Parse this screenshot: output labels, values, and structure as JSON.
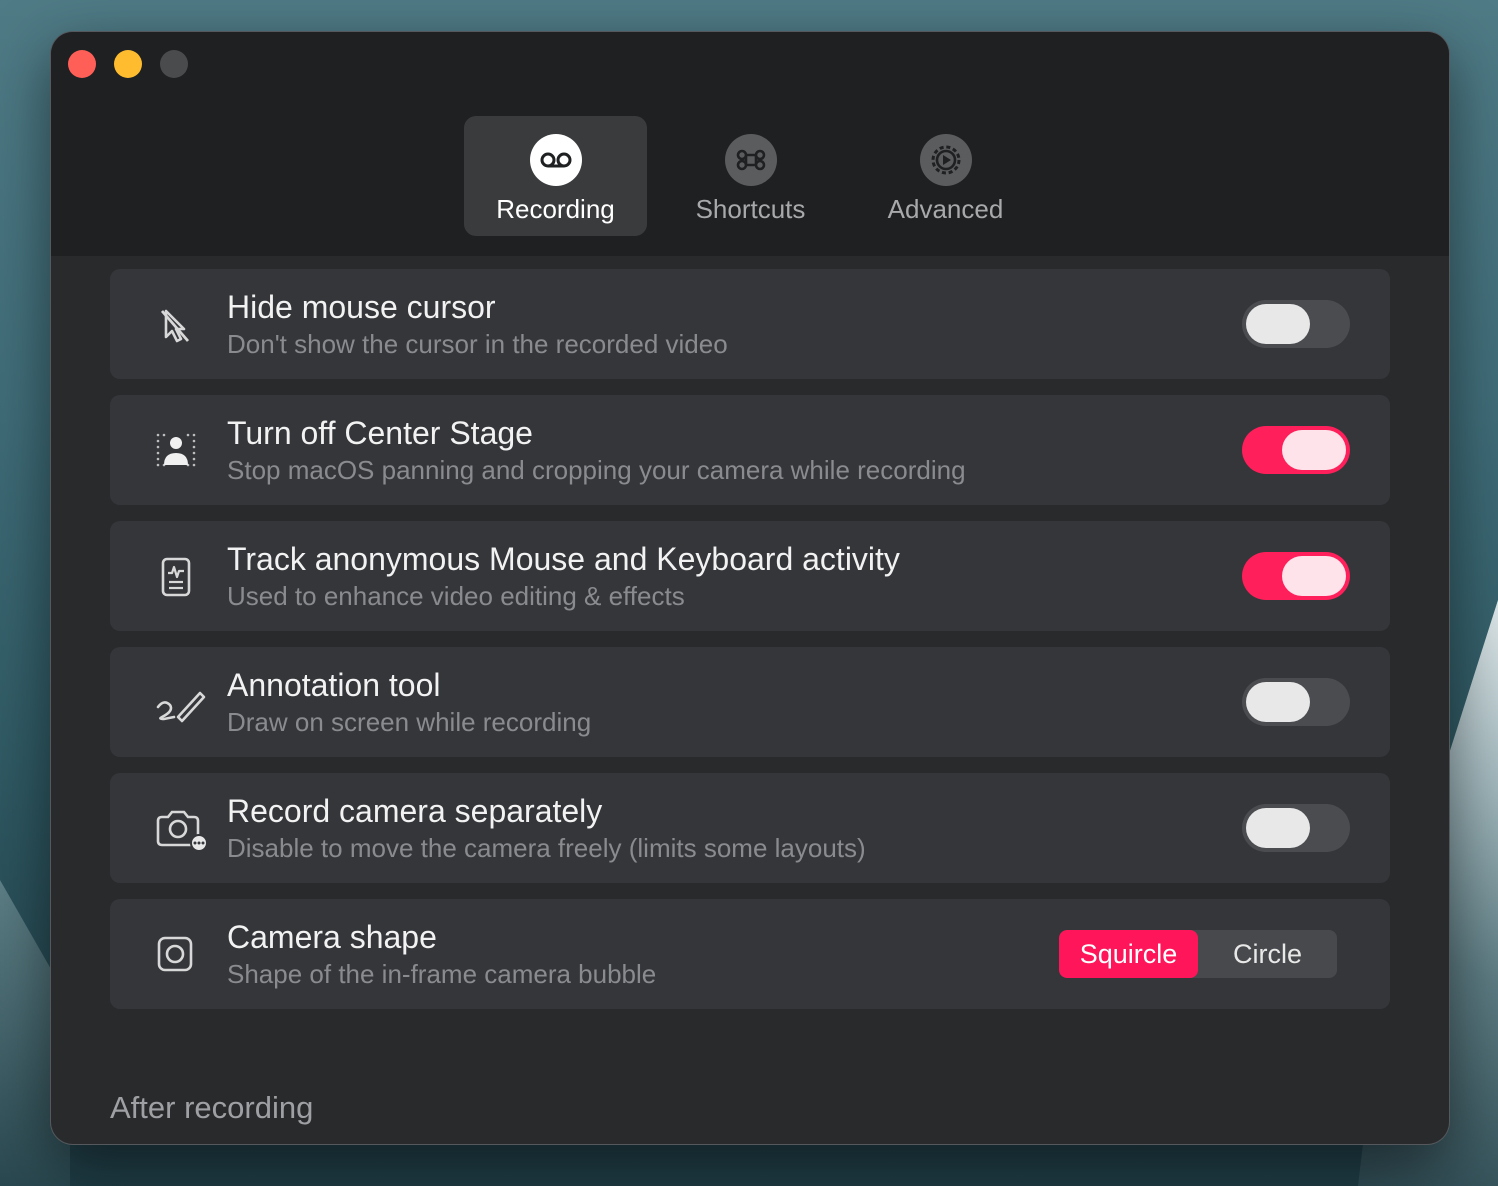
{
  "window": {
    "traffic_lights": [
      "close",
      "minimize",
      "maximize"
    ]
  },
  "tabs": [
    {
      "label": "Recording",
      "icon": "voicemail-icon",
      "active": true
    },
    {
      "label": "Shortcuts",
      "icon": "command-icon",
      "active": false
    },
    {
      "label": "Advanced",
      "icon": "gear-icon",
      "active": false
    }
  ],
  "settings": [
    {
      "icon": "cursor-slash-icon",
      "title": "Hide mouse cursor",
      "subtitle": "Don't show the cursor in the recorded video",
      "enabled": false
    },
    {
      "icon": "center-stage-icon",
      "title": "Turn off Center Stage",
      "subtitle": "Stop macOS panning and cropping your camera while recording",
      "enabled": true
    },
    {
      "icon": "activity-document-icon",
      "title": "Track anonymous Mouse and Keyboard activity",
      "subtitle": "Used to enhance video editing & effects",
      "enabled": true
    },
    {
      "icon": "pencil-scribble-icon",
      "title": "Annotation tool",
      "subtitle": "Draw on screen while recording",
      "enabled": false
    },
    {
      "icon": "camera-more-icon",
      "title": "Record camera separately",
      "subtitle": "Disable to move the camera freely (limits some layouts)",
      "enabled": false
    }
  ],
  "camera_shape": {
    "icon": "camera-bubble-icon",
    "title": "Camera shape",
    "subtitle": "Shape of the in-frame camera bubble",
    "options": [
      "Squircle",
      "Circle"
    ],
    "selected": "Squircle"
  },
  "after_recording": {
    "heading": "After recording"
  },
  "colors": {
    "accent": "#ff1f5a",
    "window_bg": "#282a2c",
    "card_bg": "#34363a"
  }
}
